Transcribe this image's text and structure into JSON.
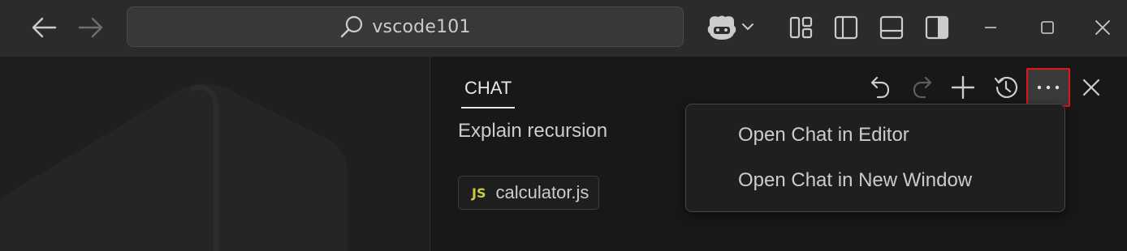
{
  "titlebar": {
    "search_text": "vscode101",
    "icons": {
      "back": "arrow-left-icon",
      "forward": "arrow-right-icon",
      "search": "search-icon",
      "copilot": "copilot-icon",
      "customize_layout": "customize-layout-icon",
      "toggle_primary_sidebar": "sidebar-left-icon",
      "toggle_panel": "panel-bottom-icon",
      "toggle_secondary_sidebar": "sidebar-right-icon",
      "minimize": "minimize-icon",
      "maximize": "maximize-icon",
      "close": "close-icon"
    }
  },
  "chat": {
    "tab_label": "CHAT",
    "message": "Explain recursion",
    "attachment": {
      "badge": "JS",
      "file_name": "calculator.js"
    },
    "toolbar_icons": [
      "undo-icon",
      "redo-icon",
      "new-chat-icon",
      "history-icon",
      "more-actions-icon",
      "close-icon"
    ]
  },
  "menu": {
    "items": [
      {
        "label": "Open Chat in Editor"
      },
      {
        "label": "Open Chat in New Window"
      }
    ]
  },
  "colors": {
    "titlebar_bg": "#2b2b2b",
    "chat_bg": "#181818",
    "highlight_border": "#e3161b",
    "js_badge": "#cbcb41"
  }
}
